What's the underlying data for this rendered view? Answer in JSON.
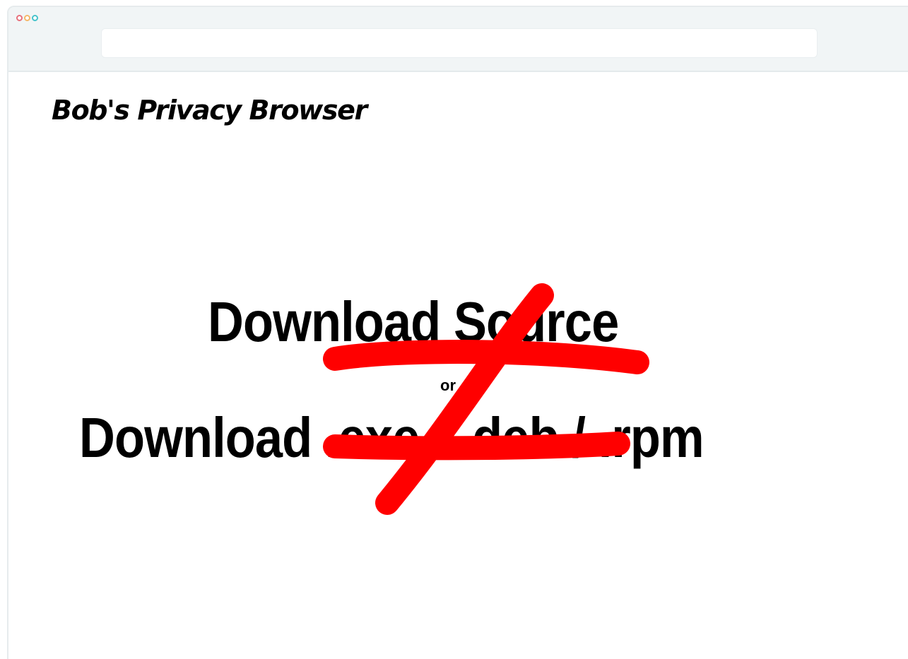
{
  "browser": {
    "address_value": "",
    "traffic_lights": {
      "close_color": "#e7717d",
      "minimize_color": "#f5b86a",
      "zoom_color": "#46c3cb"
    }
  },
  "page": {
    "title": "Bob's Privacy Browser",
    "download_source_label": "Download Source",
    "separator": "or",
    "download_binaries_label": "Download .exe / .deb / .rpm"
  },
  "annotation": {
    "symbol": "not-equal",
    "color": "#ff0000"
  }
}
